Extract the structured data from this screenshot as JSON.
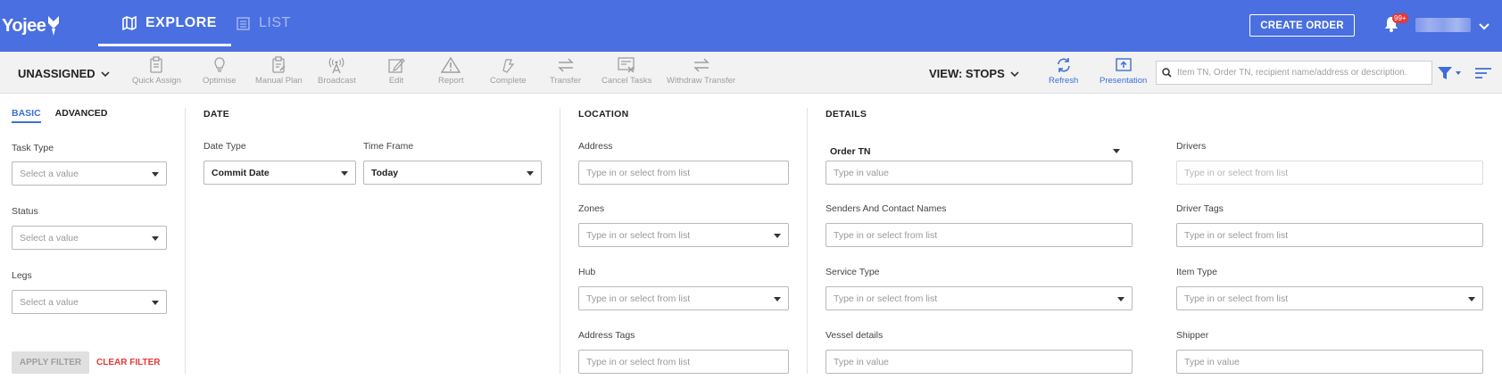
{
  "app": {
    "logo_text": "Yojee"
  },
  "nav": {
    "tabs": [
      {
        "label": "EXPLORE",
        "active": true
      },
      {
        "label": "LIST",
        "active": false
      }
    ],
    "create_order_label": "CREATE ORDER",
    "notifications_badge": "99+"
  },
  "toolbar": {
    "unassigned_label": "UNASSIGNED",
    "tools": [
      {
        "label": "Quick Assign",
        "icon": "quick-assign-icon"
      },
      {
        "label": "Optimise",
        "icon": "bulb-icon"
      },
      {
        "label": "Manual Plan",
        "icon": "manual-plan-icon"
      },
      {
        "label": "Broadcast",
        "icon": "broadcast-icon"
      },
      {
        "label": "Edit",
        "icon": "edit-icon"
      },
      {
        "label": "Report",
        "icon": "warning-icon"
      },
      {
        "label": "Complete",
        "icon": "complete-icon"
      },
      {
        "label": "Transfer",
        "icon": "transfer-icon"
      },
      {
        "label": "Cancel Tasks",
        "icon": "cancel-tasks-icon"
      },
      {
        "label": "Withdraw Transfer",
        "icon": "withdraw-transfer-icon"
      }
    ],
    "view_label": "VIEW: STOPS",
    "refresh_label": "Refresh",
    "presentation_label": "Presentation",
    "search_placeholder": "Item TN, Order TN, recipient name/address or description.",
    "accent_color": "#3d6ed8"
  },
  "filter": {
    "tabs": {
      "basic": "BASIC",
      "advanced": "ADVANCED"
    },
    "basic": {
      "task_type": {
        "label": "Task Type",
        "placeholder": "Select a value"
      },
      "status": {
        "label": "Status",
        "placeholder": "Select a value"
      },
      "legs": {
        "label": "Legs",
        "placeholder": "Select a value"
      }
    },
    "apply_label": "APPLY FILTER",
    "clear_label": "CLEAR FILTER",
    "date": {
      "title": "DATE",
      "date_type": {
        "label": "Date Type",
        "value": "Commit Date"
      },
      "time_frame": {
        "label": "Time Frame",
        "value": "Today"
      }
    },
    "location": {
      "title": "LOCATION",
      "address": {
        "label": "Address",
        "placeholder": "Type in or select from list"
      },
      "zones": {
        "label": "Zones",
        "placeholder": "Type in or select from list"
      },
      "hub": {
        "label": "Hub",
        "placeholder": "Type in or select from list"
      },
      "address_tags": {
        "label": "Address Tags",
        "placeholder": "Type in or select from list"
      }
    },
    "details": {
      "title": "DETAILS",
      "order_tn_select": "Order TN",
      "order_tn": {
        "placeholder": "Type in value"
      },
      "senders": {
        "label": "Senders And Contact Names",
        "placeholder": "Type in or select from list"
      },
      "service_type": {
        "label": "Service Type",
        "placeholder": "Type in or select from list"
      },
      "vessel": {
        "label": "Vessel details",
        "placeholder": "Type in value"
      },
      "drivers": {
        "label": "Drivers",
        "placeholder": "Type in or select from list"
      },
      "driver_tags": {
        "label": "Driver Tags",
        "placeholder": "Type in or select from list"
      },
      "item_type": {
        "label": "Item Type",
        "placeholder": "Type in or select from list"
      },
      "shipper": {
        "label": "Shipper",
        "placeholder": "Type in value"
      }
    }
  }
}
